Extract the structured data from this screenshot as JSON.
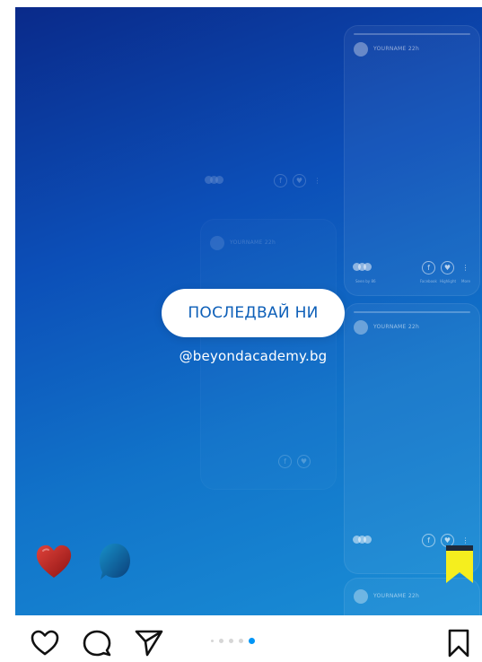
{
  "post": {
    "cta_label": "ПОСЛЕДВАЙ НИ",
    "handle": "@beyondacademy.bg"
  },
  "mockups": {
    "username_label": "YOURNAME",
    "time_label": "22h",
    "facebook_label": "Facebook",
    "highlight_label": "Highlight",
    "more_label": "More",
    "seen_label": "Seen by 86"
  },
  "carousel": {
    "count": 5,
    "active_index": 4
  },
  "colors": {
    "accent": "#0095f6",
    "gradient_start": "#0a2a8a",
    "gradient_end": "#1a8fd6",
    "cta_text": "#0d5fb8"
  },
  "icons": {
    "like": "heart-outline-icon",
    "comment": "comment-bubble-icon",
    "share": "paper-plane-icon",
    "save": "bookmark-outline-icon"
  }
}
